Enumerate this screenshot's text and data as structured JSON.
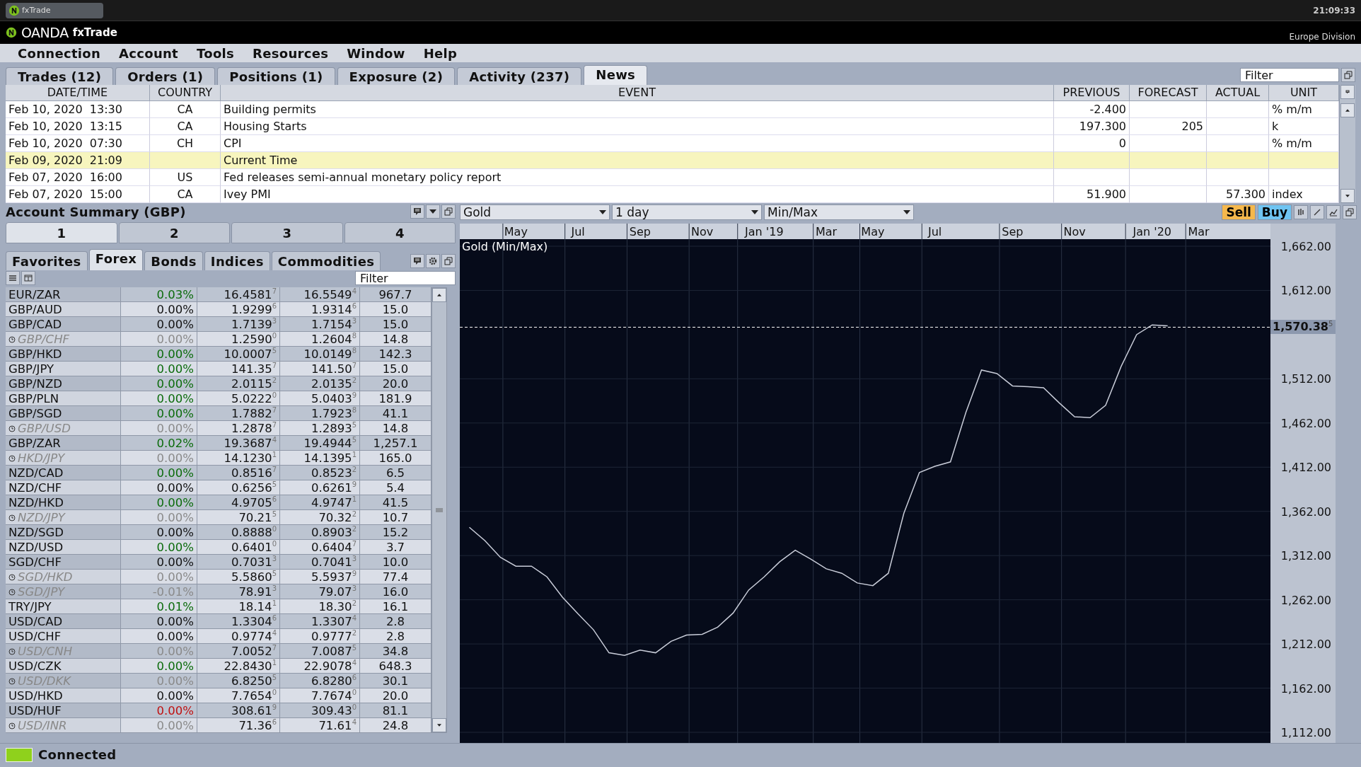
{
  "title_bar": {
    "app_title": "fxTrade",
    "clock": "21:09:33"
  },
  "brand_bar": {
    "logo_text": "OANDA",
    "product": "fxTrade",
    "division": "Europe Division"
  },
  "menu": [
    "Connection",
    "Account",
    "Tools",
    "Resources",
    "Window",
    "Help"
  ],
  "news_panel": {
    "tabs": [
      {
        "label": "Trades (12)",
        "selected": false
      },
      {
        "label": "Orders (1)",
        "selected": false
      },
      {
        "label": "Positions (1)",
        "selected": false
      },
      {
        "label": "Exposure (2)",
        "selected": false
      },
      {
        "label": "Activity (237)",
        "selected": false
      },
      {
        "label": "News",
        "selected": true
      }
    ],
    "filter": {
      "placeholder": "Filter"
    },
    "columns": [
      "DATE/TIME",
      "COUNTRY",
      "EVENT",
      "PREVIOUS",
      "FORECAST",
      "ACTUAL",
      "UNIT"
    ],
    "rows": [
      {
        "date_time": "Feb 10, 2020  13:30",
        "country": "CA",
        "event": "Building permits",
        "previous": "-2.400",
        "unit": "% m/m",
        "current": false
      },
      {
        "date_time": "Feb 10, 2020  13:15",
        "country": "CA",
        "event": "Housing Starts",
        "previous": "197.300",
        "forecast": "205",
        "unit": "k",
        "current": false
      },
      {
        "date_time": "Feb 10, 2020  07:30",
        "country": "CH",
        "event": "CPI",
        "previous": "0",
        "unit": "% m/m",
        "current": false
      },
      {
        "date_time": "Feb 09, 2020  21:09",
        "event": "Current Time",
        "current": true
      },
      {
        "date_time": "Feb 07, 2020  16:00",
        "country": "US",
        "event": "Fed releases semi-annual monetary policy report",
        "current": false
      },
      {
        "date_time": "Feb 07, 2020  15:00",
        "country": "CA",
        "event": "Ivey PMI",
        "previous": "51.900",
        "actual": "57.300",
        "unit": "index",
        "current": false
      }
    ]
  },
  "account_summary": {
    "title": "Account Summary (GBP)",
    "pages": [
      {
        "label": "1",
        "selected": true
      },
      {
        "label": "2",
        "selected": false
      },
      {
        "label": "3",
        "selected": false
      },
      {
        "label": "4",
        "selected": false
      }
    ],
    "categories": [
      {
        "label": "Favorites",
        "selected": false
      },
      {
        "label": "Forex",
        "selected": true
      },
      {
        "label": "Bonds",
        "selected": false
      },
      {
        "label": "Indices",
        "selected": false
      },
      {
        "label": "Commodities",
        "selected": false
      }
    ],
    "filter": {
      "placeholder": "Filter"
    },
    "rows": [
      {
        "pair": "EUR/ZAR",
        "change": "0.03%",
        "color": "#0b6b0b",
        "bid": "16.4581$^{7}$",
        "ask": "16.5549$^{4}$",
        "spread": "967.7",
        "halted": false
      },
      {
        "pair": "GBP/AUD",
        "change": "0.00%",
        "color": "#111111",
        "bid": "1.9299$^{6}$",
        "ask": "1.9314$^{6}$",
        "spread": "15.0",
        "halted": false
      },
      {
        "pair": "GBP/CAD",
        "change": "0.00%",
        "color": "#111111",
        "bid": "1.7139$^{3}$",
        "ask": "1.7154$^{3}$",
        "spread": "15.0",
        "halted": false
      },
      {
        "pair": "GBP/CHF",
        "change": "0.00%",
        "color": "#8a8a8a",
        "bid": "1.2590$^{0}$",
        "ask": "1.2604$^{8}$",
        "spread": "14.8",
        "halted": true
      },
      {
        "pair": "GBP/HKD",
        "change": "0.00%",
        "color": "#0b6b0b",
        "bid": "10.0007$^{5}$",
        "ask": "10.0149$^{8}$",
        "spread": "142.3",
        "halted": false
      },
      {
        "pair": "GBP/JPY",
        "change": "0.00%",
        "color": "#0b6b0b",
        "bid": "141.35$^{7}$",
        "ask": "141.50$^{7}$",
        "spread": "15.0",
        "halted": false
      },
      {
        "pair": "GBP/NZD",
        "change": "0.00%",
        "color": "#0b6b0b",
        "bid": "2.0115$^{2}$",
        "ask": "2.0135$^{2}$",
        "spread": "20.0",
        "halted": false
      },
      {
        "pair": "GBP/PLN",
        "change": "0.00%",
        "color": "#0b6b0b",
        "bid": "5.0222$^{0}$",
        "ask": "5.0403$^{9}$",
        "spread": "181.9",
        "halted": false
      },
      {
        "pair": "GBP/SGD",
        "change": "0.00%",
        "color": "#0b6b0b",
        "bid": "1.7882$^{7}$",
        "ask": "1.7923$^{8}$",
        "spread": "41.1",
        "halted": false
      },
      {
        "pair": "GBP/USD",
        "change": "0.00%",
        "color": "#8a8a8a",
        "bid": "1.2878$^{7}$",
        "ask": "1.2893$^{5}$",
        "spread": "14.8",
        "halted": true
      },
      {
        "pair": "GBP/ZAR",
        "change": "0.02%",
        "color": "#0b6b0b",
        "bid": "19.3687$^{4}$",
        "ask": "19.4944$^{5}$",
        "spread": "1,257.1",
        "halted": false
      },
      {
        "pair": "HKD/JPY",
        "change": "0.00%",
        "color": "#8a8a8a",
        "bid": "14.1230$^{1}$",
        "ask": "14.1395$^{1}$",
        "spread": "165.0",
        "halted": true
      },
      {
        "pair": "NZD/CAD",
        "change": "0.00%",
        "color": "#0b6b0b",
        "bid": "0.8516$^{7}$",
        "ask": "0.8523$^{2}$",
        "spread": "6.5",
        "halted": false
      },
      {
        "pair": "NZD/CHF",
        "change": "0.00%",
        "color": "#111111",
        "bid": "0.6256$^{5}$",
        "ask": "0.6261$^{9}$",
        "spread": "5.4",
        "halted": false
      },
      {
        "pair": "NZD/HKD",
        "change": "0.00%",
        "color": "#0b6b0b",
        "bid": "4.9705$^{6}$",
        "ask": "4.9747$^{1}$",
        "spread": "41.5",
        "halted": false
      },
      {
        "pair": "NZD/JPY",
        "change": "0.00%",
        "color": "#8a8a8a",
        "bid": "70.21$^{5}$",
        "ask": "70.32$^{2}$",
        "spread": "10.7",
        "halted": true
      },
      {
        "pair": "NZD/SGD",
        "change": "0.00%",
        "color": "#111111",
        "bid": "0.8888$^{0}$",
        "ask": "0.8903$^{2}$",
        "spread": "15.2",
        "halted": false
      },
      {
        "pair": "NZD/USD",
        "change": "0.00%",
        "color": "#0b6b0b",
        "bid": "0.6401$^{0}$",
        "ask": "0.6404$^{7}$",
        "spread": "3.7",
        "halted": false
      },
      {
        "pair": "SGD/CHF",
        "change": "0.00%",
        "color": "#111111",
        "bid": "0.7031$^{3}$",
        "ask": "0.7041$^{3}$",
        "spread": "10.0",
        "halted": false
      },
      {
        "pair": "SGD/HKD",
        "change": "0.00%",
        "color": "#8a8a8a",
        "bid": "5.5860$^{5}$",
        "ask": "5.5937$^{9}$",
        "spread": "77.4",
        "halted": true
      },
      {
        "pair": "SGD/JPY",
        "change": "-0.01%",
        "color": "#8a8a8a",
        "bid": "78.91$^{3}$",
        "ask": "79.07$^{3}$",
        "spread": "16.0",
        "halted": true
      },
      {
        "pair": "TRY/JPY",
        "change": "0.01%",
        "color": "#0b6b0b",
        "bid": "18.14$^{1}$",
        "ask": "18.30$^{2}$",
        "spread": "16.1",
        "halted": false
      },
      {
        "pair": "USD/CAD",
        "change": "0.00%",
        "color": "#111111",
        "bid": "1.3304$^{6}$",
        "ask": "1.3307$^{4}$",
        "spread": "2.8",
        "halted": false
      },
      {
        "pair": "USD/CHF",
        "change": "0.00%",
        "color": "#111111",
        "bid": "0.9774$^{4}$",
        "ask": "0.9777$^{2}$",
        "spread": "2.8",
        "halted": false
      },
      {
        "pair": "USD/CNH",
        "change": "0.00%",
        "color": "#8a8a8a",
        "bid": "7.0052$^{7}$",
        "ask": "7.0087$^{5}$",
        "spread": "34.8",
        "halted": true
      },
      {
        "pair": "USD/CZK",
        "change": "0.00%",
        "color": "#0b6b0b",
        "bid": "22.8430$^{1}$",
        "ask": "22.9078$^{4}$",
        "spread": "648.3",
        "halted": false
      },
      {
        "pair": "USD/DKK",
        "change": "0.00%",
        "color": "#8a8a8a",
        "bid": "6.8250$^{5}$",
        "ask": "6.8280$^{6}$",
        "spread": "30.1",
        "halted": true
      },
      {
        "pair": "USD/HKD",
        "change": "0.00%",
        "color": "#111111",
        "bid": "7.7654$^{0}$",
        "ask": "7.7674$^{0}$",
        "spread": "20.0",
        "halted": false
      },
      {
        "pair": "USD/HUF",
        "change": "0.00%",
        "color": "#c01010",
        "bid": "308.61$^{9}$",
        "ask": "309.43$^{0}$",
        "spread": "81.1",
        "halted": false
      },
      {
        "pair": "USD/INR",
        "change": "0.00%",
        "color": "#8a8a8a",
        "bid": "71.36$^{6}$",
        "ask": "71.61$^{4}$",
        "spread": "24.8",
        "halted": true
      }
    ]
  },
  "chart_panel": {
    "instrument": "Gold",
    "interval": "1 day",
    "mode": "Min/Max",
    "sell": "Sell",
    "buy": "Buy",
    "chart_data": {
      "type": "line",
      "title": "Gold (Min/Max)",
      "categories": [
        null,
        null,
        null,
        "May",
        null,
        null,
        null,
        "Jul",
        null,
        null,
        null,
        "Sep",
        null,
        null,
        null,
        "Nov",
        null,
        null,
        null,
        "Jan '19",
        null,
        null,
        null,
        "Mar",
        null,
        null,
        "May",
        null,
        null,
        null,
        "Jul",
        null,
        null,
        null,
        null,
        "Sep",
        null,
        null,
        null,
        "Nov",
        null,
        null,
        null,
        null,
        "Jan '20",
        null,
        null,
        "Mar",
        null,
        null,
        null,
        null
      ],
      "series": [
        {
          "color": "#c8ccd8",
          "values": [
            1344,
            1329,
            1310,
            1300,
            1300,
            1288,
            1265,
            1246,
            1228,
            1202,
            1199,
            1205,
            1202,
            1215,
            1222,
            1223,
            1231,
            1247,
            1273,
            1288,
            1305,
            1318,
            1308,
            1297,
            1292,
            1281,
            1278,
            1292,
            1360,
            1406,
            1413,
            1418,
            1474,
            1522,
            1518,
            1504,
            1503,
            1502,
            1485,
            1469,
            1468,
            1482,
            1526,
            1562,
            1573,
            1572,
            null,
            null,
            null,
            null,
            null,
            null
          ]
        }
      ],
      "ylim": [
        1100,
        1670
      ],
      "yticks": [
        {
          "value": 1662,
          "label": "1,662.00"
        },
        {
          "value": 1612,
          "label": "1,612.00"
        },
        {
          "value": 1512,
          "label": "1,512.00"
        },
        {
          "value": 1462,
          "label": "1,462.00"
        },
        {
          "value": 1412,
          "label": "1,412.00"
        },
        {
          "value": 1362,
          "label": "1,362.00"
        },
        {
          "value": 1312,
          "label": "1,312.00"
        },
        {
          "value": 1262,
          "label": "1,262.00"
        },
        {
          "value": 1212,
          "label": "1,212.00"
        },
        {
          "value": 1162,
          "label": "1,162.00"
        },
        {
          "value": 1112,
          "label": "1,112.00"
        }
      ],
      "grid": true,
      "ref_lines": [
        {
          "axis": "y",
          "value": 1570.38,
          "color": "#ffffff",
          "label": "1,570.38$^{5}$"
        }
      ]
    }
  },
  "status_bar": {
    "text": "Connected",
    "connected": true
  }
}
